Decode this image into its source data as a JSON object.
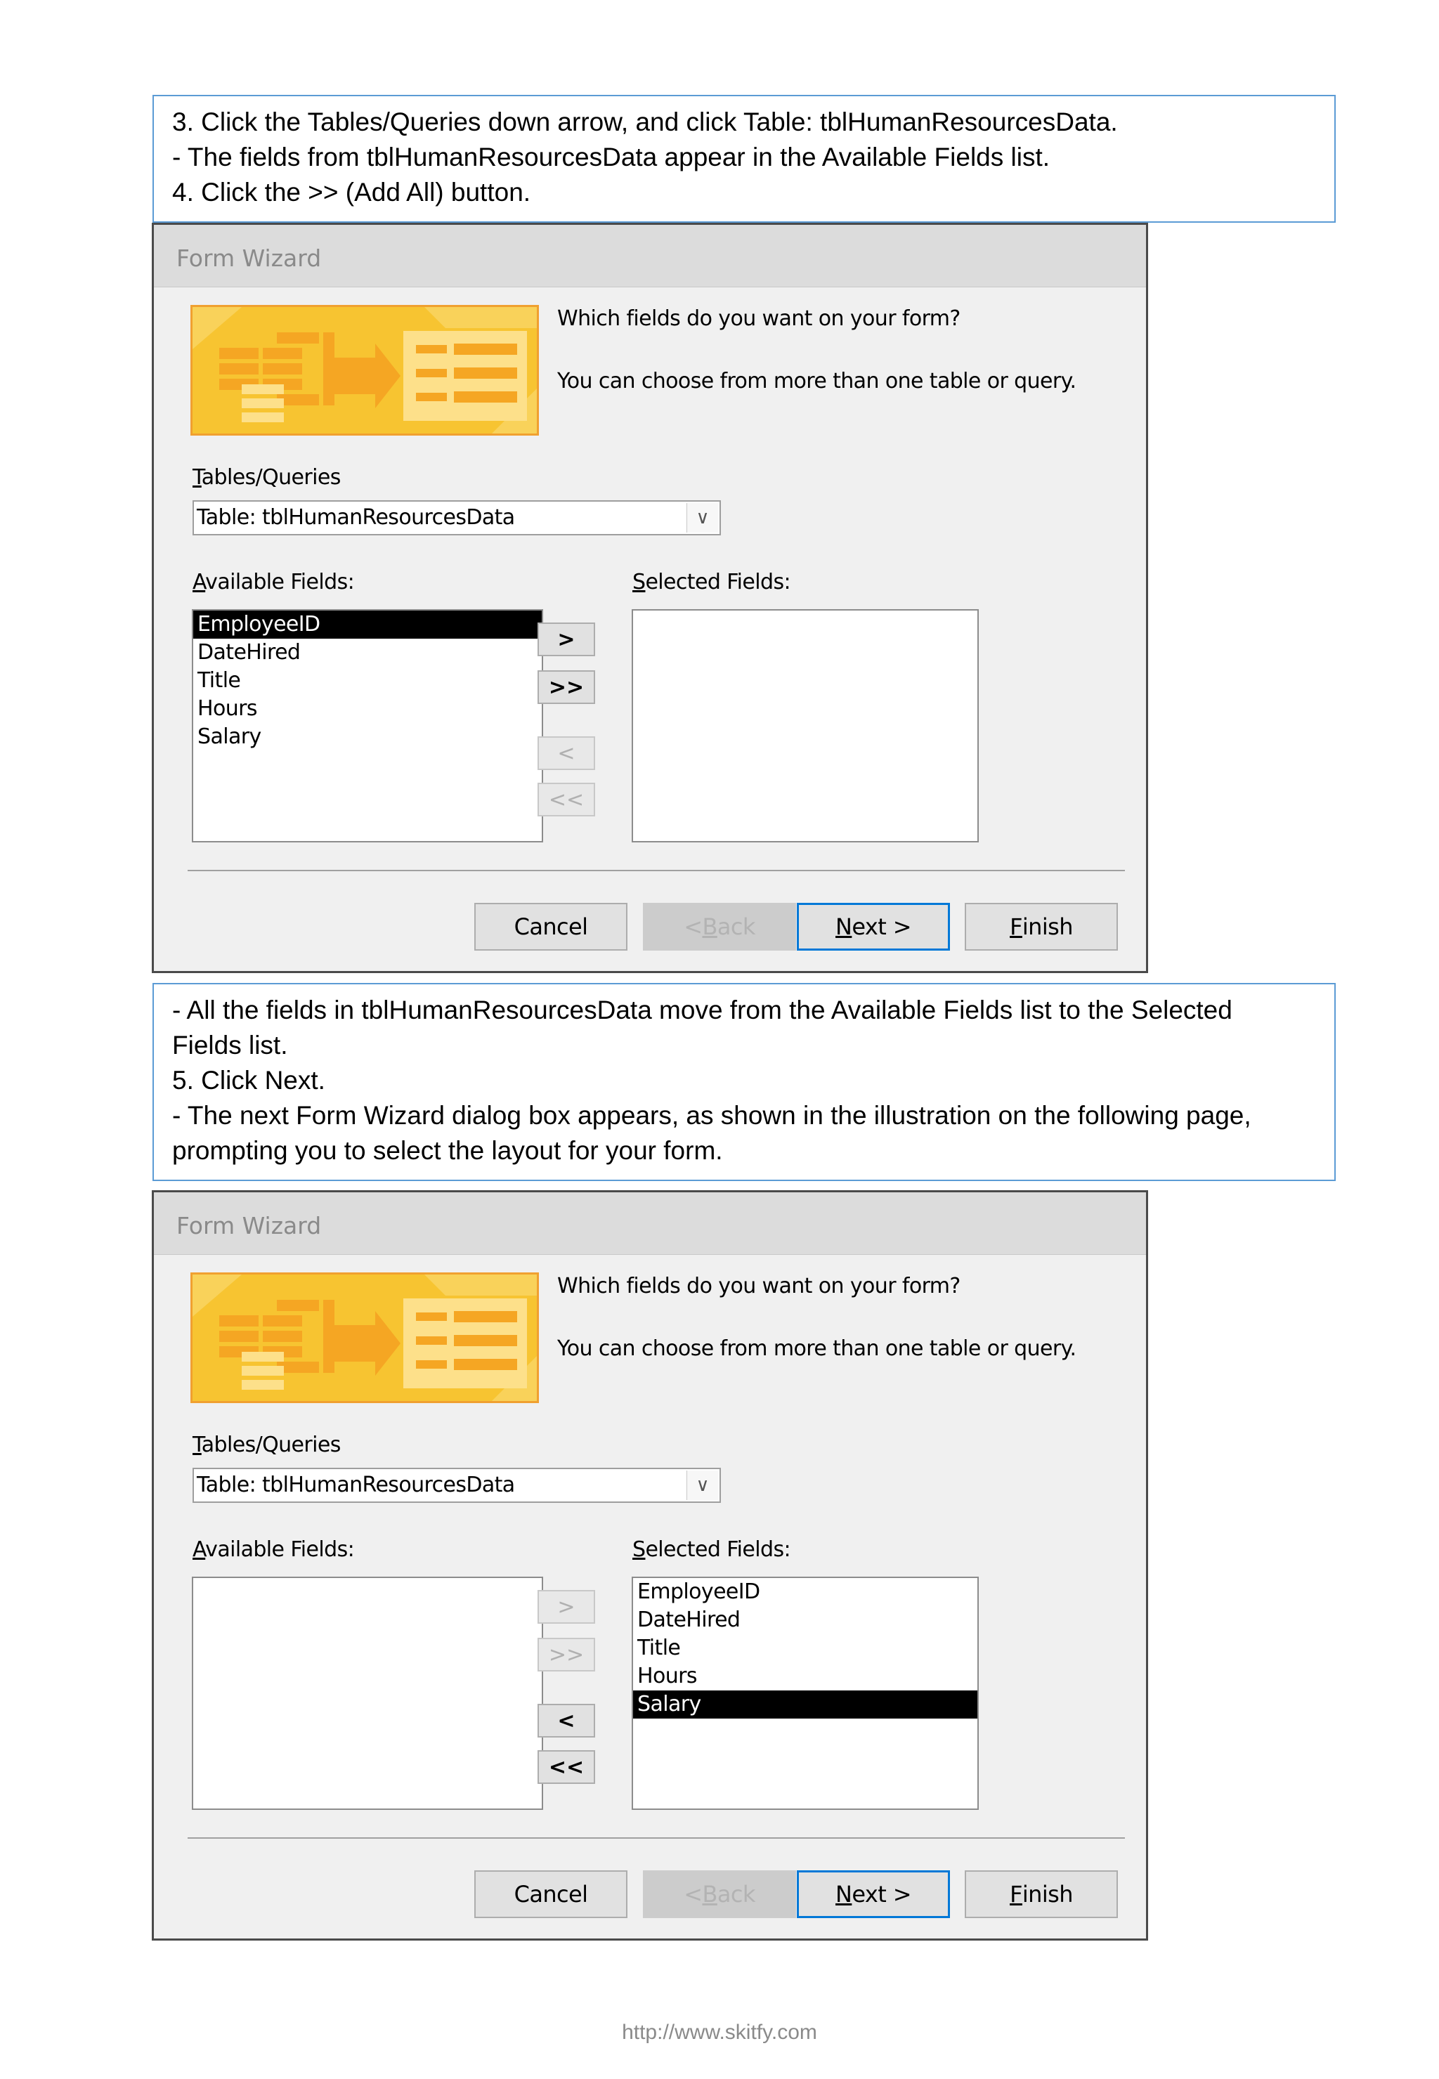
{
  "instructions_top": [
    "3. Click the Tables/Queries down arrow, and click Table: tblHumanResourcesData.",
    "- The fields from tblHumanResourcesData appear in the Available Fields list.",
    "4. Click the >> (Add All) button."
  ],
  "instructions_middle": [
    "- All the fields in tblHumanResourcesData move from the Available Fields list to the Selected",
    "Fields list.",
    "5. Click Next.",
    "- The next Form Wizard dialog box appears, as shown in the illustration on the following page,",
    "prompting you to select the layout for your form."
  ],
  "dialogs": [
    {
      "title": "Form Wizard",
      "prompt_question": "Which fields do you want on your form?",
      "prompt_hint": "You can choose from more than one table or query.",
      "tables_label_key": "T",
      "tables_label_rest": "ables/Queries",
      "table_selected": "Table: tblHumanResourcesData",
      "available_label_key": "A",
      "available_label_rest": "vailable Fields:",
      "selected_label_key": "S",
      "selected_label_rest": "elected Fields:",
      "available_fields": [
        "EmployeeID",
        "DateHired",
        "Title",
        "Hours",
        "Salary"
      ],
      "available_highlighted": "EmployeeID",
      "selected_fields": [],
      "move_buttons": [
        ">",
        ">>",
        "<",
        "<<"
      ],
      "move_enabled": [
        true,
        true,
        false,
        false
      ],
      "cancel_label": "Cancel",
      "back_key": "B",
      "back_prefix": "< ",
      "back_rest": "ack",
      "next_key": "N",
      "next_rest": "ext >",
      "finish_key": "F",
      "finish_rest": "inish"
    },
    {
      "title": "Form Wizard",
      "prompt_question": "Which fields do you want on your form?",
      "prompt_hint": "You can choose from more than one table or query.",
      "tables_label_key": "T",
      "tables_label_rest": "ables/Queries",
      "table_selected": "Table: tblHumanResourcesData",
      "available_label_key": "A",
      "available_label_rest": "vailable Fields:",
      "selected_label_key": "S",
      "selected_label_rest": "elected Fields:",
      "available_fields": [],
      "selected_fields": [
        "EmployeeID",
        "DateHired",
        "Title",
        "Hours",
        "Salary"
      ],
      "selected_highlighted": "Salary",
      "move_buttons": [
        ">",
        ">>",
        "<",
        "<<"
      ],
      "move_enabled": [
        false,
        false,
        true,
        true
      ],
      "cancel_label": "Cancel",
      "back_key": "B",
      "back_prefix": "< ",
      "back_rest": "ack",
      "next_key": "N",
      "next_rest": "ext >",
      "finish_key": "F",
      "finish_rest": "inish"
    }
  ],
  "hero_colors": {
    "background": "#f7c431",
    "border": "#f0a030",
    "shapes": "#f5a623",
    "light": "#fde08a"
  },
  "footer_url": "http://www.skitfy.com"
}
